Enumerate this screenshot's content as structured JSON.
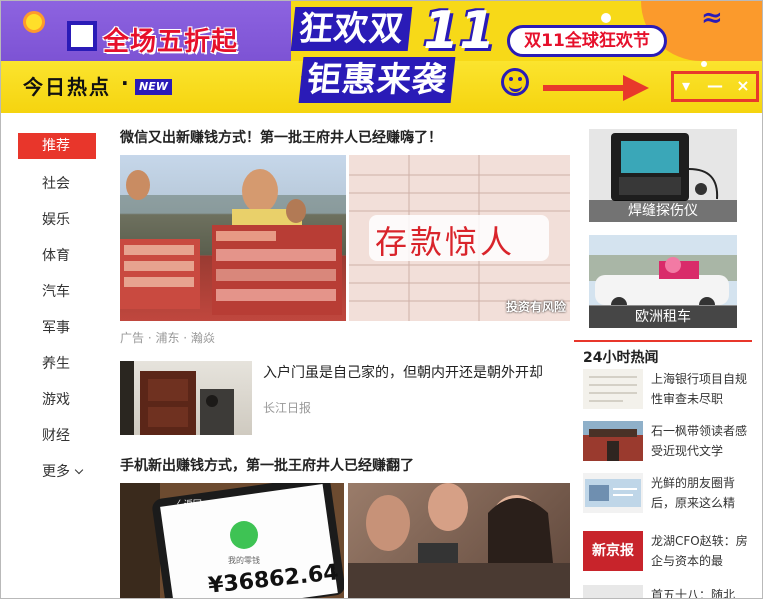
{
  "banner": {
    "sale_left": "全场五折起",
    "hero_line1": "狂欢双",
    "hero_number": "11",
    "hero_line2": "钜惠来袭",
    "pill_text": "双11全球狂欢节",
    "today_label": "今日热点",
    "today_dot": "·",
    "new_badge": "NEW",
    "controls": {
      "menu": "▾",
      "minimize": "—",
      "close": "×"
    }
  },
  "colors": {
    "accent": "#e8362b",
    "banner_yellow": "#f7d918",
    "banner_blue": "#2a1bb7",
    "banner_purple": "#8d63e0"
  },
  "sidebar": {
    "items": [
      {
        "label": "推荐",
        "active": true
      },
      {
        "label": "社会"
      },
      {
        "label": "娱乐"
      },
      {
        "label": "体育"
      },
      {
        "label": "汽车"
      },
      {
        "label": "军事"
      },
      {
        "label": "养生"
      },
      {
        "label": "游戏"
      },
      {
        "label": "财经"
      },
      {
        "label": "更多"
      }
    ]
  },
  "main": {
    "article1": {
      "title": "微信又出新赚钱方式！第一批王府井人已经赚嗨了！",
      "img_right_text": "存款惊人",
      "img_right_caption": "投资有风险",
      "meta": "广告 · 浦东 · 瀚焱"
    },
    "article2": {
      "title": "入户门虽是自己家的，但朝内开还是朝外开却",
      "source": "长江日报"
    },
    "article3": {
      "title": "手机新出赚钱方式，第一批王府井人已经赚翻了",
      "img_left_text": "¥36862.64",
      "img_left_sub": "我的零钱",
      "img_left_back": "〈 返回"
    }
  },
  "right": {
    "thumb1_caption": "焊缝探伤仪",
    "thumb2_caption": "欧洲租车",
    "hot_title": "24小时热闻",
    "hot_items": [
      {
        "text": "上海银行项目自规性审查未尽职"
      },
      {
        "text": "石一枫带领读者感受近现代文学"
      },
      {
        "text": "光鲜的朋友圈背后，原来这么精"
      },
      {
        "text": "龙湖CFO赵轶：房企与资本的最",
        "logo": "新京报"
      },
      {
        "text": "首五十八：随北"
      }
    ]
  }
}
